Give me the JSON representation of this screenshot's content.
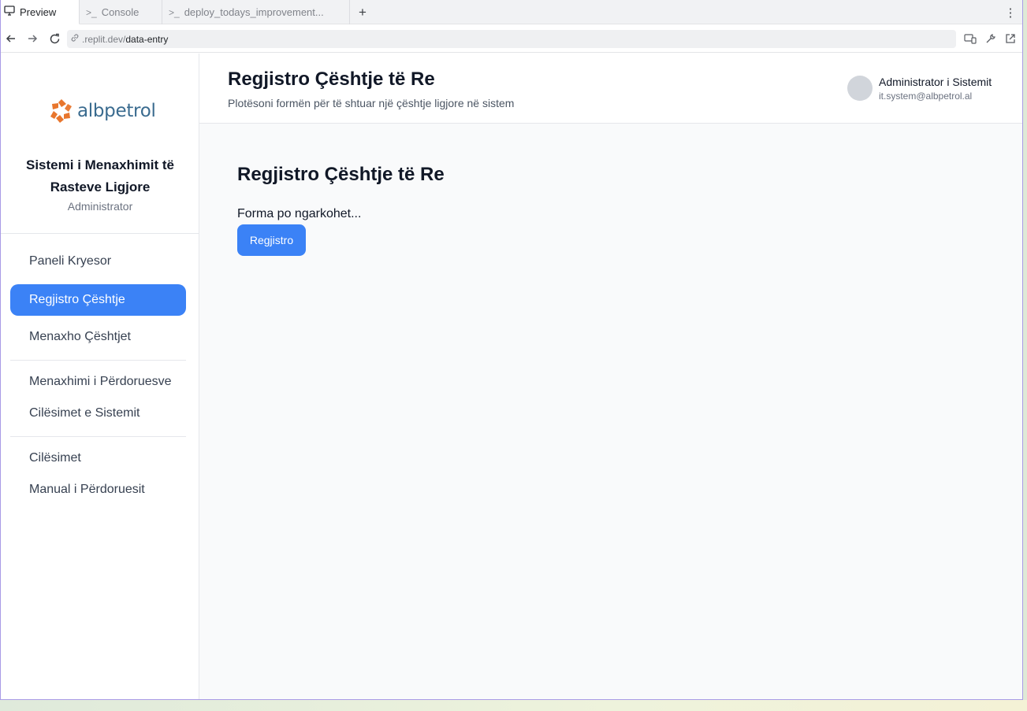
{
  "browser": {
    "tabs": [
      {
        "label": "Preview",
        "icon": "monitor-icon",
        "active": true
      },
      {
        "label": "Console",
        "icon": "terminal-icon",
        "active": false
      },
      {
        "label": "deploy_todays_improvement...",
        "icon": "terminal-icon",
        "active": false
      }
    ],
    "add_tab_icon": "plus-icon",
    "menu_icon": "kebab-menu-icon",
    "url_host": ".replit.dev/",
    "url_path": "data-entry"
  },
  "sidebar": {
    "logo_text": "albpetrol",
    "system_title": "Sistemi i Menaxhimit të Rasteve Ligjore",
    "role": "Administrator",
    "nav_groups": [
      [
        "Paneli Kryesor",
        "Regjistro Çështje",
        "Menaxho Çështjet"
      ],
      [
        "Menaxhimi i Përdoruesve",
        "Cilësimet e Sistemit"
      ],
      [
        "Cilësimet",
        "Manual i Përdoruesit"
      ]
    ],
    "active_item": "Regjistro Çështje"
  },
  "header": {
    "title": "Regjistro Çështje të Re",
    "subtitle": "Plotësoni formën për të shtuar një çështje ligjore në sistem",
    "user_name": "Administrator i Sistemit",
    "user_email": "it.system@albpetrol.al"
  },
  "main": {
    "form_title": "Regjistro Çështje të Re",
    "loading_text": "Forma po ngarkohet...",
    "submit_label": "Regjistro"
  },
  "colors": {
    "accent": "#3b82f6",
    "logo_orange": "#e8762d",
    "logo_blue": "#3a6b8f"
  }
}
